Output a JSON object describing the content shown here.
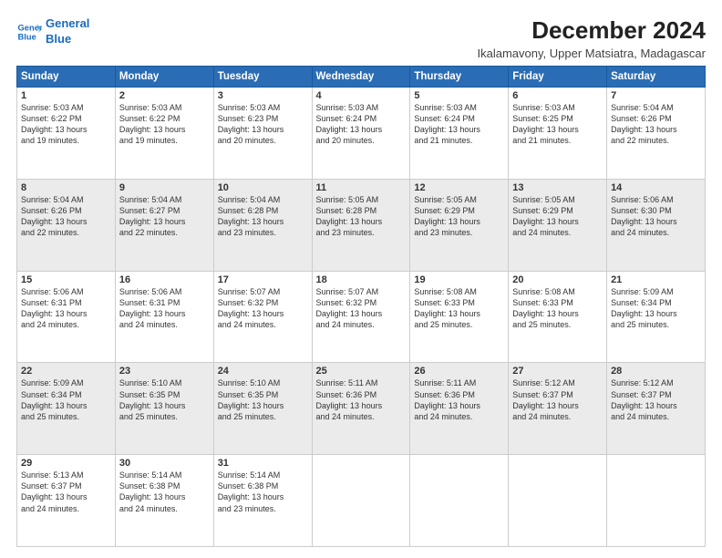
{
  "header": {
    "logo_line1": "General",
    "logo_line2": "Blue",
    "title": "December 2024",
    "subtitle": "Ikalamavony, Upper Matsiatra, Madagascar"
  },
  "days_of_week": [
    "Sunday",
    "Monday",
    "Tuesday",
    "Wednesday",
    "Thursday",
    "Friday",
    "Saturday"
  ],
  "weeks": [
    [
      {
        "day": "1",
        "sunrise": "5:03 AM",
        "sunset": "6:22 PM",
        "daylight": "13 hours and 19 minutes."
      },
      {
        "day": "2",
        "sunrise": "5:03 AM",
        "sunset": "6:22 PM",
        "daylight": "13 hours and 19 minutes."
      },
      {
        "day": "3",
        "sunrise": "5:03 AM",
        "sunset": "6:23 PM",
        "daylight": "13 hours and 20 minutes."
      },
      {
        "day": "4",
        "sunrise": "5:03 AM",
        "sunset": "6:24 PM",
        "daylight": "13 hours and 20 minutes."
      },
      {
        "day": "5",
        "sunrise": "5:03 AM",
        "sunset": "6:24 PM",
        "daylight": "13 hours and 21 minutes."
      },
      {
        "day": "6",
        "sunrise": "5:03 AM",
        "sunset": "6:25 PM",
        "daylight": "13 hours and 21 minutes."
      },
      {
        "day": "7",
        "sunrise": "5:04 AM",
        "sunset": "6:26 PM",
        "daylight": "13 hours and 22 minutes."
      }
    ],
    [
      {
        "day": "8",
        "sunrise": "5:04 AM",
        "sunset": "6:26 PM",
        "daylight": "13 hours and 22 minutes."
      },
      {
        "day": "9",
        "sunrise": "5:04 AM",
        "sunset": "6:27 PM",
        "daylight": "13 hours and 22 minutes."
      },
      {
        "day": "10",
        "sunrise": "5:04 AM",
        "sunset": "6:28 PM",
        "daylight": "13 hours and 23 minutes."
      },
      {
        "day": "11",
        "sunrise": "5:05 AM",
        "sunset": "6:28 PM",
        "daylight": "13 hours and 23 minutes."
      },
      {
        "day": "12",
        "sunrise": "5:05 AM",
        "sunset": "6:29 PM",
        "daylight": "13 hours and 23 minutes."
      },
      {
        "day": "13",
        "sunrise": "5:05 AM",
        "sunset": "6:29 PM",
        "daylight": "13 hours and 24 minutes."
      },
      {
        "day": "14",
        "sunrise": "5:06 AM",
        "sunset": "6:30 PM",
        "daylight": "13 hours and 24 minutes."
      }
    ],
    [
      {
        "day": "15",
        "sunrise": "5:06 AM",
        "sunset": "6:31 PM",
        "daylight": "13 hours and 24 minutes."
      },
      {
        "day": "16",
        "sunrise": "5:06 AM",
        "sunset": "6:31 PM",
        "daylight": "13 hours and 24 minutes."
      },
      {
        "day": "17",
        "sunrise": "5:07 AM",
        "sunset": "6:32 PM",
        "daylight": "13 hours and 24 minutes."
      },
      {
        "day": "18",
        "sunrise": "5:07 AM",
        "sunset": "6:32 PM",
        "daylight": "13 hours and 24 minutes."
      },
      {
        "day": "19",
        "sunrise": "5:08 AM",
        "sunset": "6:33 PM",
        "daylight": "13 hours and 25 minutes."
      },
      {
        "day": "20",
        "sunrise": "5:08 AM",
        "sunset": "6:33 PM",
        "daylight": "13 hours and 25 minutes."
      },
      {
        "day": "21",
        "sunrise": "5:09 AM",
        "sunset": "6:34 PM",
        "daylight": "13 hours and 25 minutes."
      }
    ],
    [
      {
        "day": "22",
        "sunrise": "5:09 AM",
        "sunset": "6:34 PM",
        "daylight": "13 hours and 25 minutes."
      },
      {
        "day": "23",
        "sunrise": "5:10 AM",
        "sunset": "6:35 PM",
        "daylight": "13 hours and 25 minutes."
      },
      {
        "day": "24",
        "sunrise": "5:10 AM",
        "sunset": "6:35 PM",
        "daylight": "13 hours and 25 minutes."
      },
      {
        "day": "25",
        "sunrise": "5:11 AM",
        "sunset": "6:36 PM",
        "daylight": "13 hours and 24 minutes."
      },
      {
        "day": "26",
        "sunrise": "5:11 AM",
        "sunset": "6:36 PM",
        "daylight": "13 hours and 24 minutes."
      },
      {
        "day": "27",
        "sunrise": "5:12 AM",
        "sunset": "6:37 PM",
        "daylight": "13 hours and 24 minutes."
      },
      {
        "day": "28",
        "sunrise": "5:12 AM",
        "sunset": "6:37 PM",
        "daylight": "13 hours and 24 minutes."
      }
    ],
    [
      {
        "day": "29",
        "sunrise": "5:13 AM",
        "sunset": "6:37 PM",
        "daylight": "13 hours and 24 minutes."
      },
      {
        "day": "30",
        "sunrise": "5:14 AM",
        "sunset": "6:38 PM",
        "daylight": "13 hours and 24 minutes."
      },
      {
        "day": "31",
        "sunrise": "5:14 AM",
        "sunset": "6:38 PM",
        "daylight": "13 hours and 23 minutes."
      },
      null,
      null,
      null,
      null
    ]
  ],
  "labels": {
    "sunrise": "Sunrise: ",
    "sunset": "Sunset: ",
    "daylight": "Daylight: "
  }
}
